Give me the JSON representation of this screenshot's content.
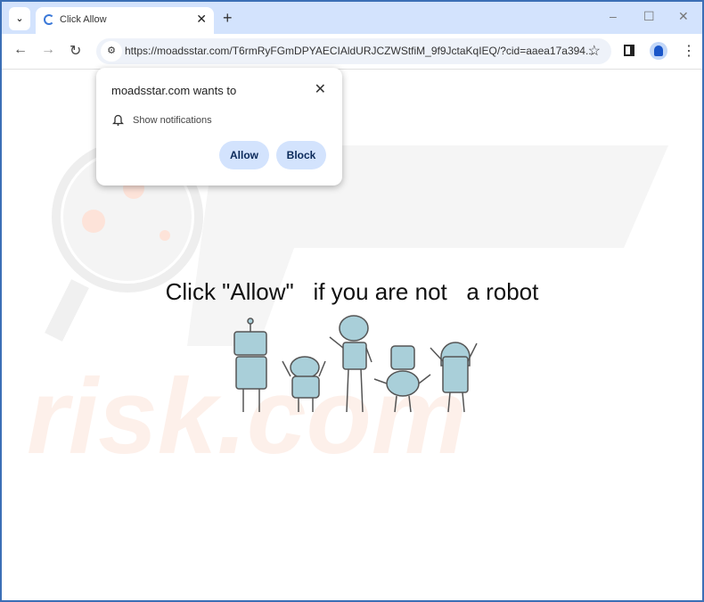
{
  "tab": {
    "title": "Click Allow",
    "close": "✕",
    "new_tab": "+",
    "list": "⌄"
  },
  "window": {
    "minimize": "–",
    "maximize": "☐",
    "close": "✕"
  },
  "toolbar": {
    "back": "←",
    "forward": "→",
    "reload": "↻",
    "url": "https://moadsstar.com/T6rmRyFGmDPYAECIAldURJCZWStfiM_9f9JctaKqIEQ/?cid=aaea17a394...",
    "bookmark": "☆",
    "menu": "⋮",
    "site_info": "⚙"
  },
  "popup": {
    "title": "moadsstar.com wants to",
    "close": "✕",
    "permission": "Show notifications",
    "bell": "🔔",
    "allow": "Allow",
    "block": "Block"
  },
  "page": {
    "message": "Click \"Allow\"   if you are not   a robot",
    "watermark": "PC risk.com"
  },
  "colors": {
    "accent": "#d3e3fd",
    "frame": "#3b6fb6"
  }
}
